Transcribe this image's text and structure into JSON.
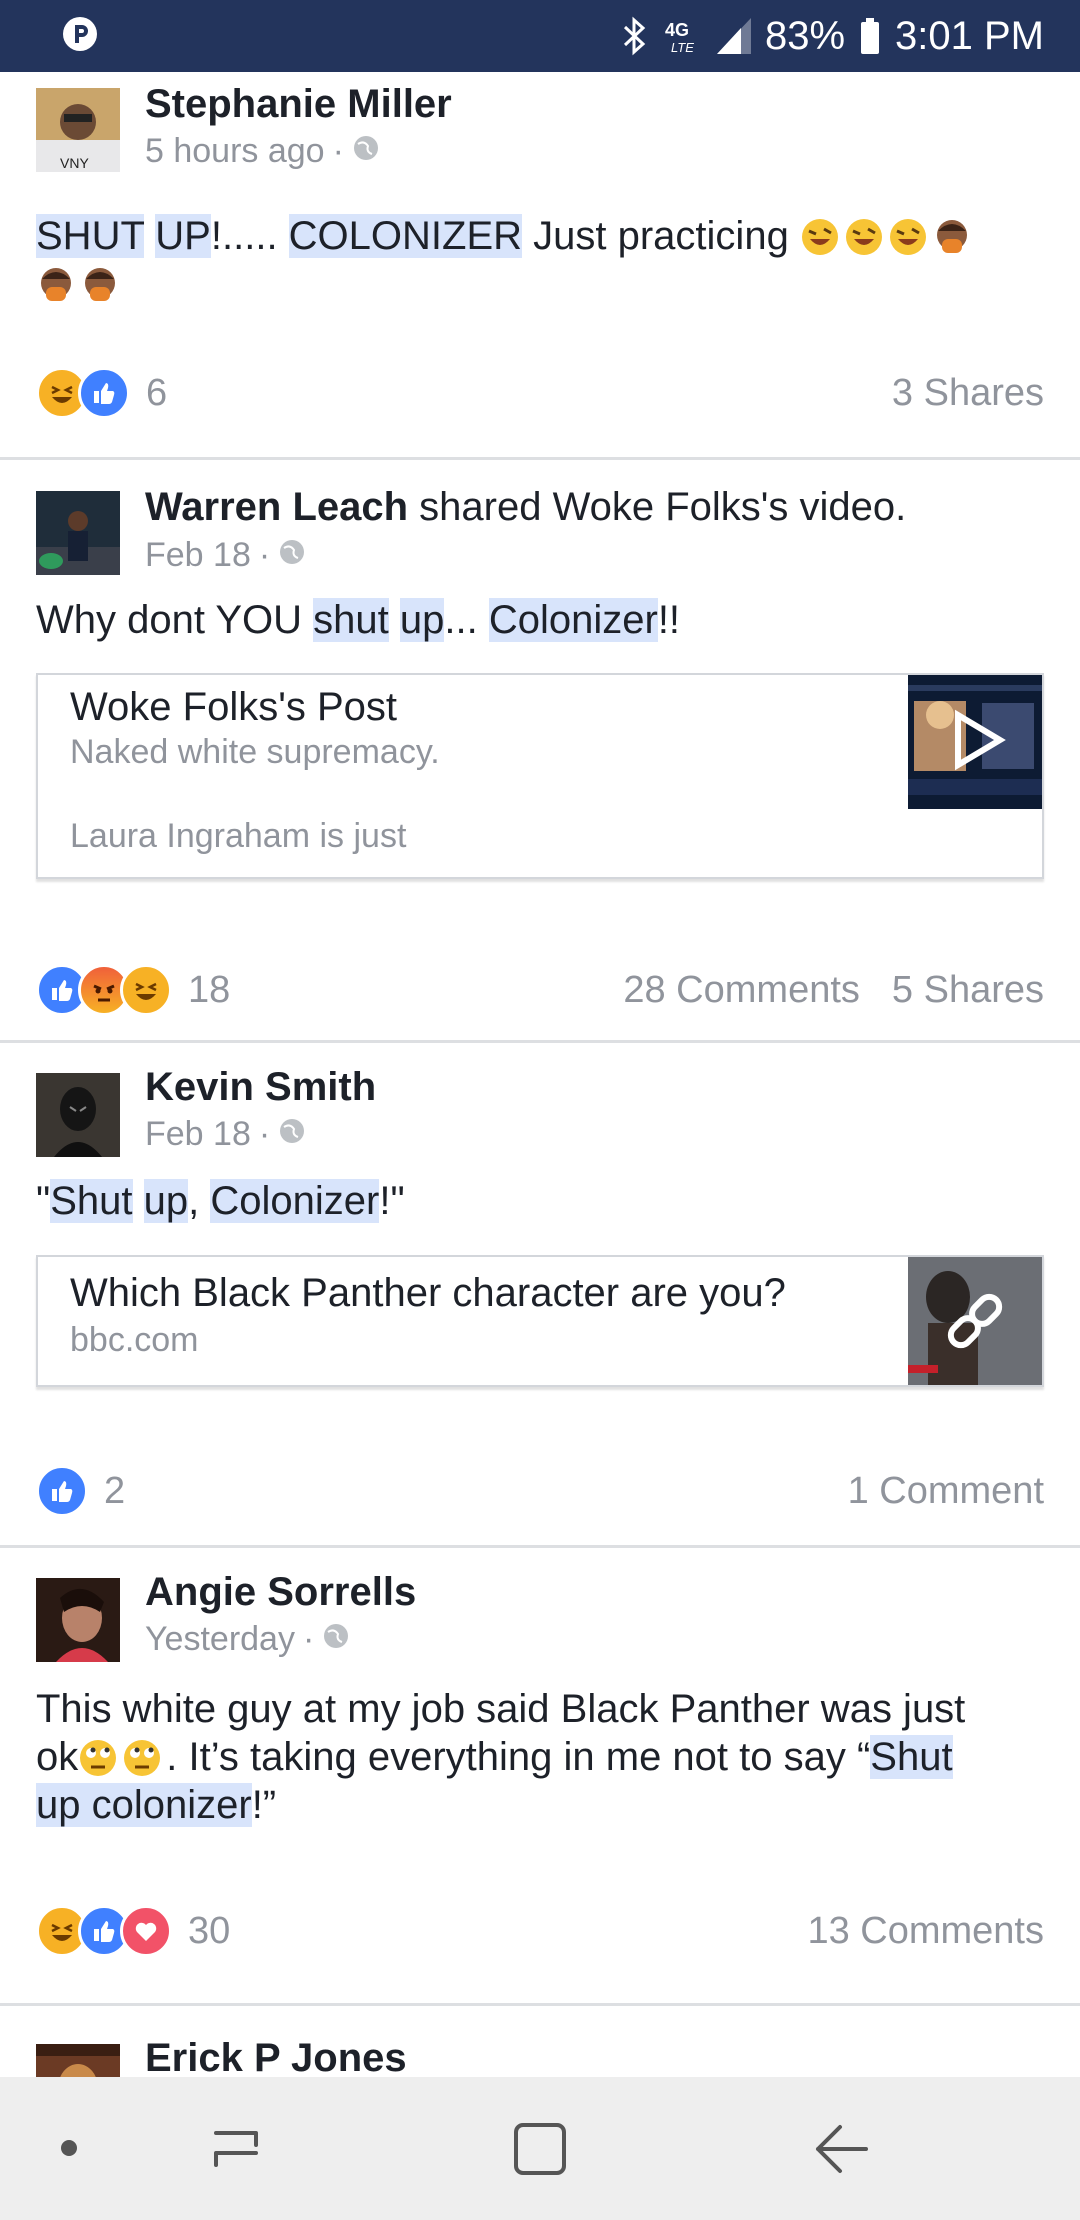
{
  "status_bar": {
    "battery": "83%",
    "time": "3:01 PM",
    "network": "4G LTE",
    "icons": [
      "app-notification-icon",
      "bluetooth-icon",
      "4g-lte-icon",
      "signal-icon",
      "battery-icon"
    ]
  },
  "posts": [
    {
      "author": "Stephanie Miller",
      "timestamp": "5 hours ago",
      "text_parts": [
        "SHUT",
        " ",
        "UP",
        "!..... ",
        "COLONIZER",
        " Just practicing "
      ],
      "reaction_count": "6",
      "shares": "3 Shares",
      "reactions": [
        "haha",
        "like"
      ]
    },
    {
      "author": "Warren Leach",
      "action": " shared Woke Folks's video.",
      "timestamp": "Feb 18",
      "text_parts": [
        "Why dont YOU ",
        "shut",
        " ",
        "up",
        "... ",
        "Colonizer",
        "!!"
      ],
      "card": {
        "title": "Woke Folks's Post",
        "subtitle": "Naked white supremacy.",
        "description": "Laura Ingraham is just"
      },
      "reaction_count": "18",
      "comments": "28 Comments",
      "shares": "5 Shares",
      "reactions": [
        "like",
        "angry",
        "haha"
      ]
    },
    {
      "author": "Kevin Smith",
      "timestamp": "Feb 18",
      "text_parts": [
        "\"",
        "Shut",
        " ",
        "up",
        ", ",
        "Colonizer",
        "!\""
      ],
      "card": {
        "title": "Which Black Panther character are you?",
        "domain": "bbc.com"
      },
      "reaction_count": "2",
      "comments": "1 Comment",
      "reactions": [
        "like"
      ]
    },
    {
      "author": "Angie Sorrells",
      "timestamp": "Yesterday",
      "text_line1": "This white guy at my job said Black Panther was just",
      "text_line2a": "ok",
      "text_line2b": ". It’s taking everything in me not to say “",
      "text_line2c": "Shut",
      "text_line3a": "up colonizer",
      "text_line3b": "!”",
      "reaction_count": "30",
      "comments": "13 Comments",
      "reactions": [
        "haha",
        "like",
        "love"
      ]
    },
    {
      "author": "Erick P Jones"
    }
  ],
  "nav_bar": {
    "buttons": [
      "dot",
      "recent-apps",
      "home",
      "back"
    ]
  },
  "colors": {
    "status_bar": "#23345c",
    "link_highlight": "#d8e4fb",
    "like": "#4080ff",
    "love": "#f25268",
    "haha_angry": "#f7b125"
  }
}
